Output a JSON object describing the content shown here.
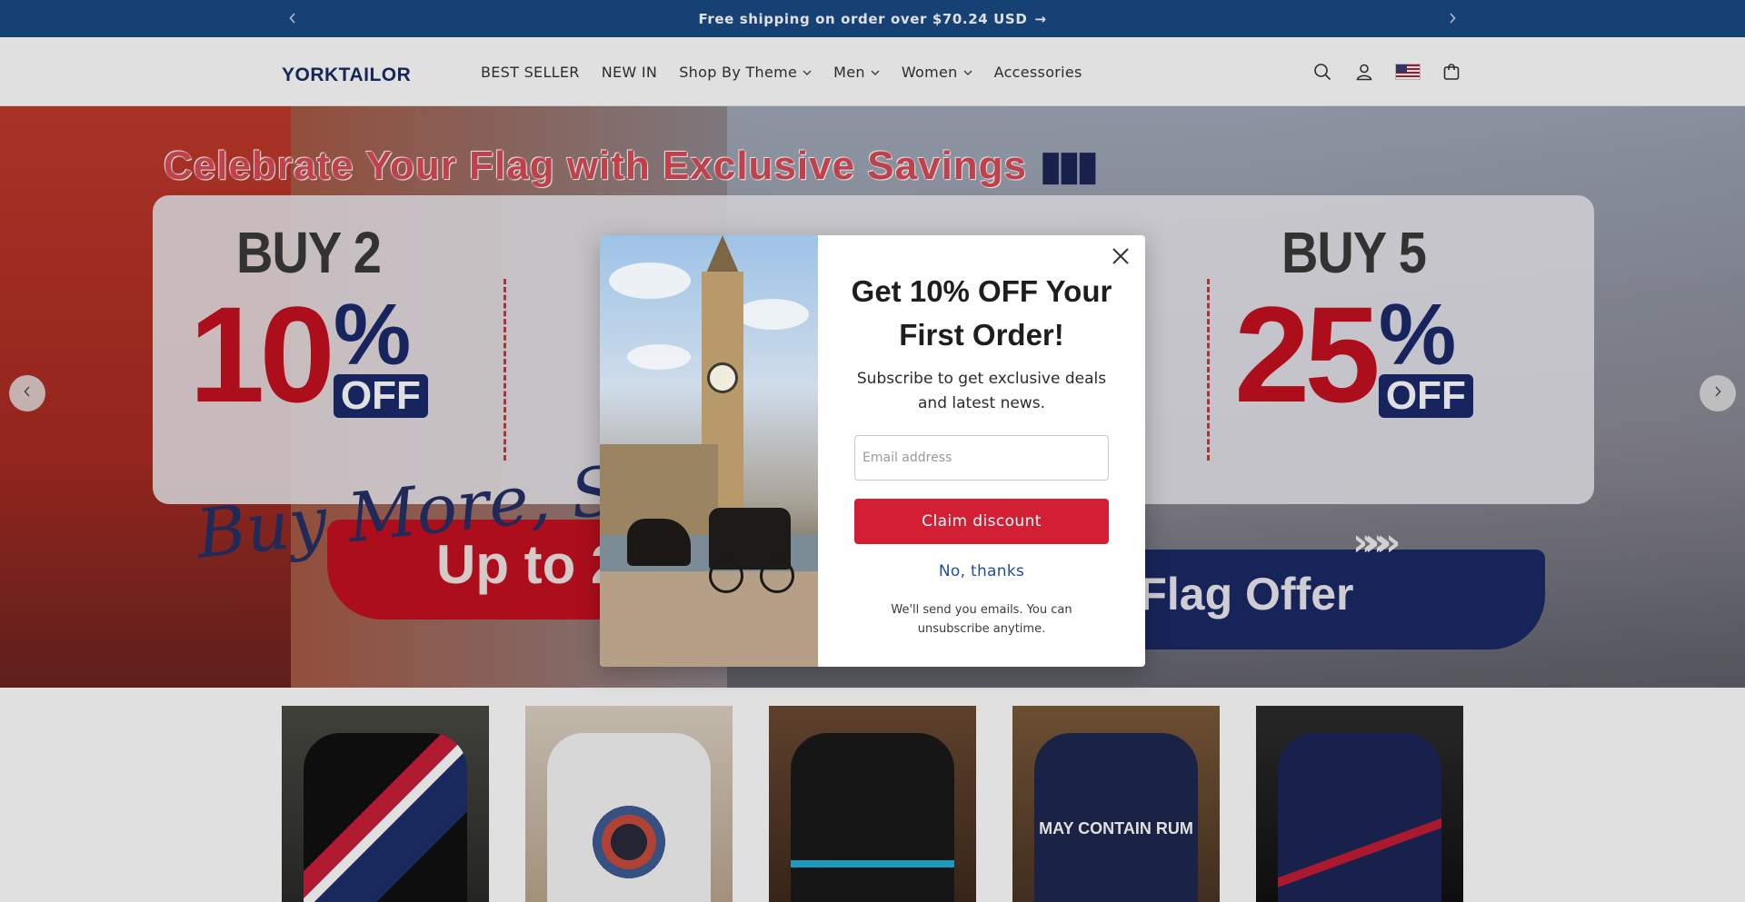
{
  "announcement": {
    "text": "Free shipping on order over $70.24 USD",
    "arrow": "→",
    "prev_icon": "chevron-left-icon",
    "next_icon": "chevron-right-icon"
  },
  "header": {
    "logo": "YORKTAILOR",
    "nav": [
      {
        "label": "BEST SELLER",
        "dropdown": false
      },
      {
        "label": "NEW IN",
        "dropdown": false
      },
      {
        "label": "Shop By Theme",
        "dropdown": true
      },
      {
        "label": "Men",
        "dropdown": true
      },
      {
        "label": "Women",
        "dropdown": true
      },
      {
        "label": "Accessories",
        "dropdown": false
      }
    ],
    "icons": [
      "search-icon",
      "account-icon",
      "us-flag-icon",
      "cart-icon"
    ]
  },
  "hero": {
    "title": "Celebrate Your Flag with Exclusive Savings",
    "deals": [
      {
        "buy": "BUY 2",
        "percent": "10",
        "off": "OFF"
      },
      {
        "buy": "BUY 5",
        "percent": "25",
        "off": "OFF"
      }
    ],
    "script_text": "Buy More, Sav",
    "up_to": "Up to 2",
    "flag_offer": "r Flag Offer",
    "chevrons": "»»»",
    "colors": {
      "deal_red": "#c4101f",
      "deal_navy": "#1c2a6a"
    }
  },
  "products": [
    {
      "label": ""
    },
    {
      "label": ""
    },
    {
      "label": ""
    },
    {
      "label": "MAY CONTAIN RUM"
    },
    {
      "label": ""
    }
  ],
  "modal": {
    "title": "Get 10% OFF Your First Order!",
    "subtitle": "Subscribe to get exclusive deals and latest news.",
    "email_placeholder": "Email address",
    "claim_label": "Claim discount",
    "decline_label": "No, thanks",
    "fine_print": "We'll send you emails. You can unsubscribe anytime.",
    "colors": {
      "claim": "#d21f33",
      "decline": "#1f4f93"
    }
  }
}
